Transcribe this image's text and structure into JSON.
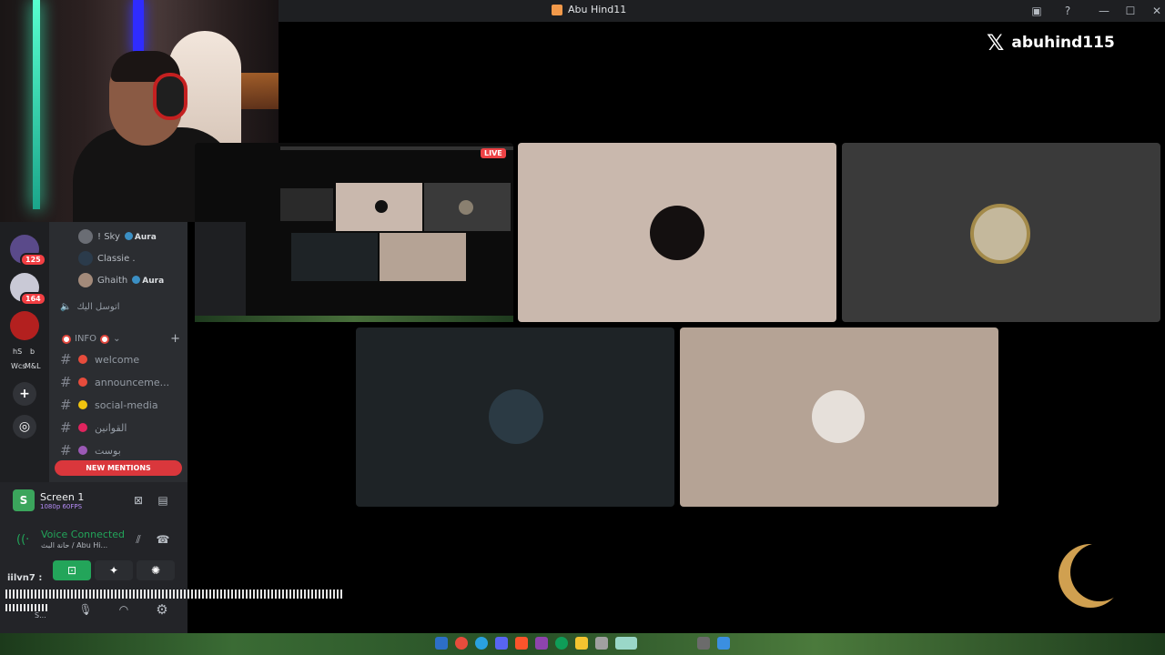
{
  "window": {
    "title": "Abu Hind11"
  },
  "overlay": {
    "x_handle": "abuhind115"
  },
  "server_rail": {
    "badges": [
      "125",
      "164"
    ],
    "labels": [
      "hS",
      "b",
      "Wcs",
      "M&L"
    ]
  },
  "members": [
    {
      "name": "! Sky",
      "badge": "Aura"
    },
    {
      "name": "Classie ."
    },
    {
      "name": "Ghaith",
      "badge": "Aura"
    }
  ],
  "voice_channel": {
    "name": "اتوسل اليك"
  },
  "category": {
    "label": "INFO"
  },
  "channels": [
    {
      "name": "welcome",
      "emoji_color": "#e74c3c"
    },
    {
      "name": "announceme...",
      "emoji_color": "#e74c3c"
    },
    {
      "name": "social-media",
      "emoji_color": "#f1c40f"
    },
    {
      "name": "القوانين",
      "emoji_color": "#e0245e"
    },
    {
      "name": "بوست",
      "emoji_color": "#9b59b6"
    }
  ],
  "new_mentions": "NEW MENTIONS",
  "screen_share": {
    "title": "Screen 1",
    "quality": "1080p 60FPS",
    "thumb_letter": "S"
  },
  "voice": {
    "status": "Voice Connected",
    "channel": "حانة البث / Abu Hi..."
  },
  "user": {
    "name": "iilvn7 :",
    "status": "S..."
  },
  "live_label": "LIVE",
  "colors": {
    "discord_bg": "#2b2d31",
    "rail_bg": "#1e1f22",
    "connected": "#23a55a",
    "mention_red": "#da373c"
  }
}
